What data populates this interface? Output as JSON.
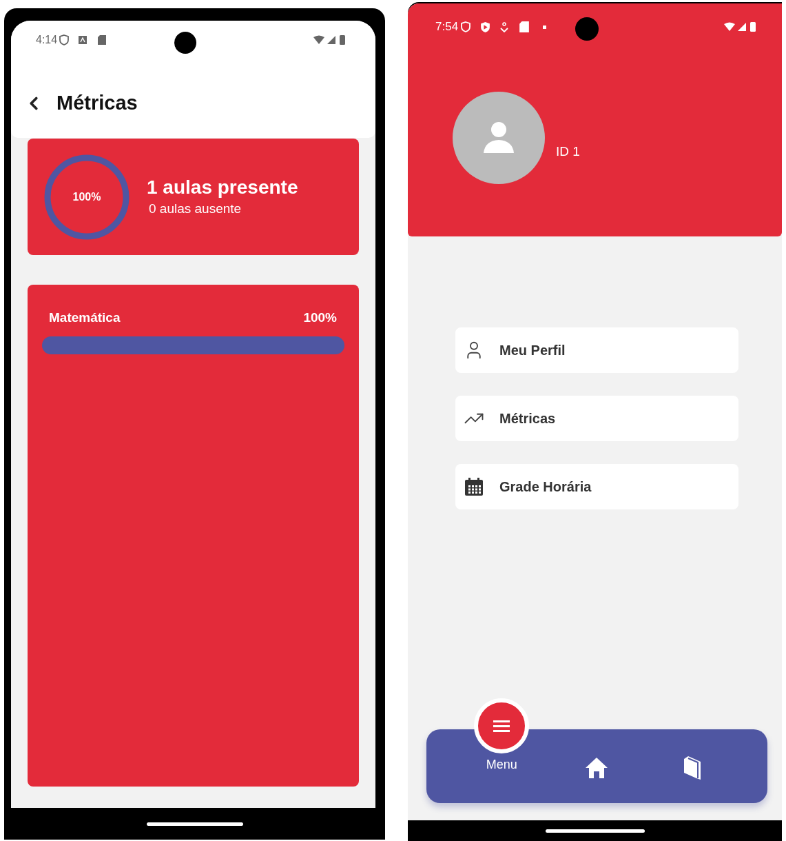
{
  "metrics_screen": {
    "status_bar": {
      "time": "4:14"
    },
    "header": {
      "title": "Métricas"
    },
    "summary": {
      "percent": "100%",
      "present": "1 aulas presente",
      "absent": "0 aulas ausente"
    },
    "subjects": [
      {
        "name": "Matemática",
        "percent": "100%"
      }
    ]
  },
  "menu_screen": {
    "status_bar": {
      "time": "7:54"
    },
    "profile": {
      "id": "ID 1"
    },
    "menu_items": [
      {
        "kind": "profile",
        "label": "Meu Perfil"
      },
      {
        "kind": "metrics",
        "label": "Métricas"
      },
      {
        "kind": "schedule",
        "label": "Grade Horária"
      }
    ],
    "bottom_nav": [
      {
        "kind": "menu",
        "label": "Menu",
        "selected": true
      },
      {
        "kind": "home",
        "selected": false
      },
      {
        "kind": "book",
        "selected": false
      }
    ]
  }
}
